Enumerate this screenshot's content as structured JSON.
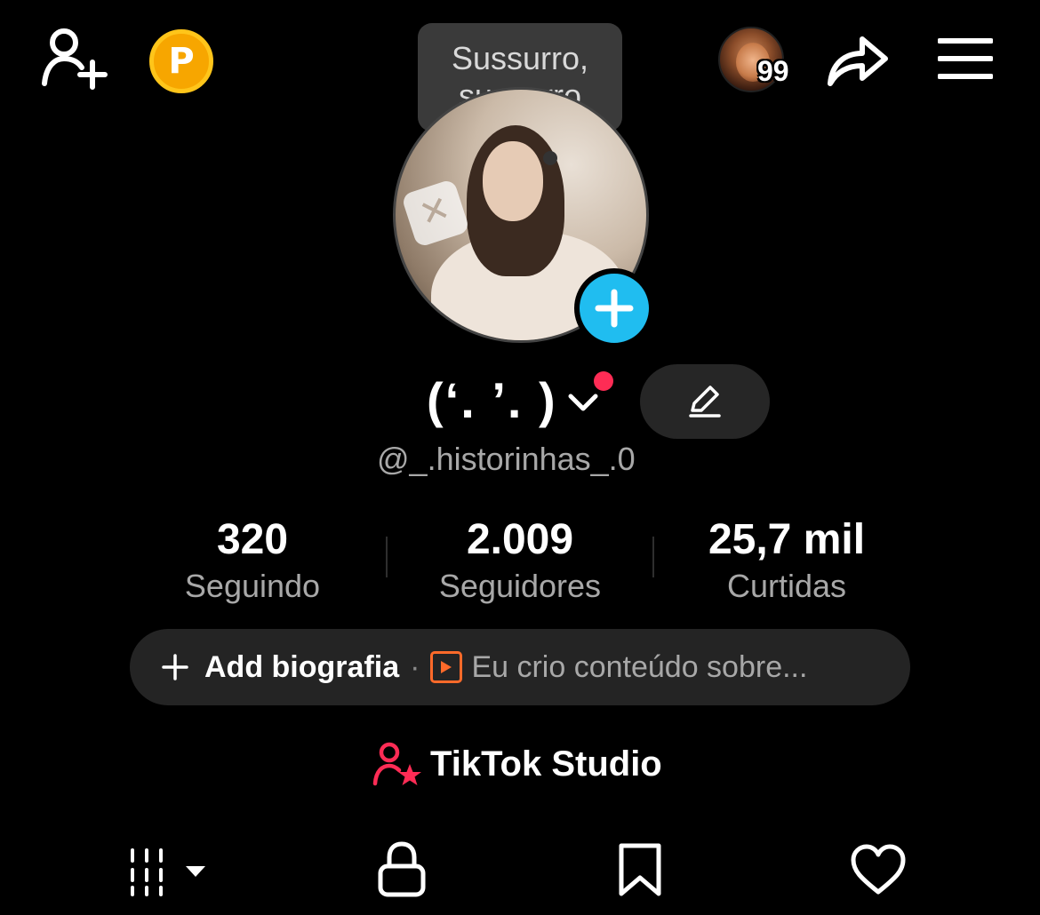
{
  "header": {
    "coin_letter": "P",
    "notification_count": "99"
  },
  "tooltip": {
    "text": "Sussurro, sussurro"
  },
  "profile": {
    "name": "(‘. ’. )",
    "handle": "@_.historinhas_.0"
  },
  "stats": [
    {
      "value": "320",
      "label": "Seguindo"
    },
    {
      "value": "2.009",
      "label": "Seguidores"
    },
    {
      "value": "25,7 mil",
      "label": "Curtidas"
    }
  ],
  "bio": {
    "add_label": "Add biografia",
    "separator": "·",
    "hint": "Eu crio conteúdo sobre..."
  },
  "studio": {
    "label": "TikTok Studio"
  },
  "tabs": [
    {
      "icon": "grid-icon"
    },
    {
      "icon": "lock-icon"
    },
    {
      "icon": "bookmark-icon"
    },
    {
      "icon": "heart-icon"
    }
  ],
  "colors": {
    "background": "#000000",
    "accent_blue": "#20BDF0",
    "accent_red": "#FE2C55",
    "coin": "#F7A600",
    "bio_icon": "#FF6A2A"
  }
}
